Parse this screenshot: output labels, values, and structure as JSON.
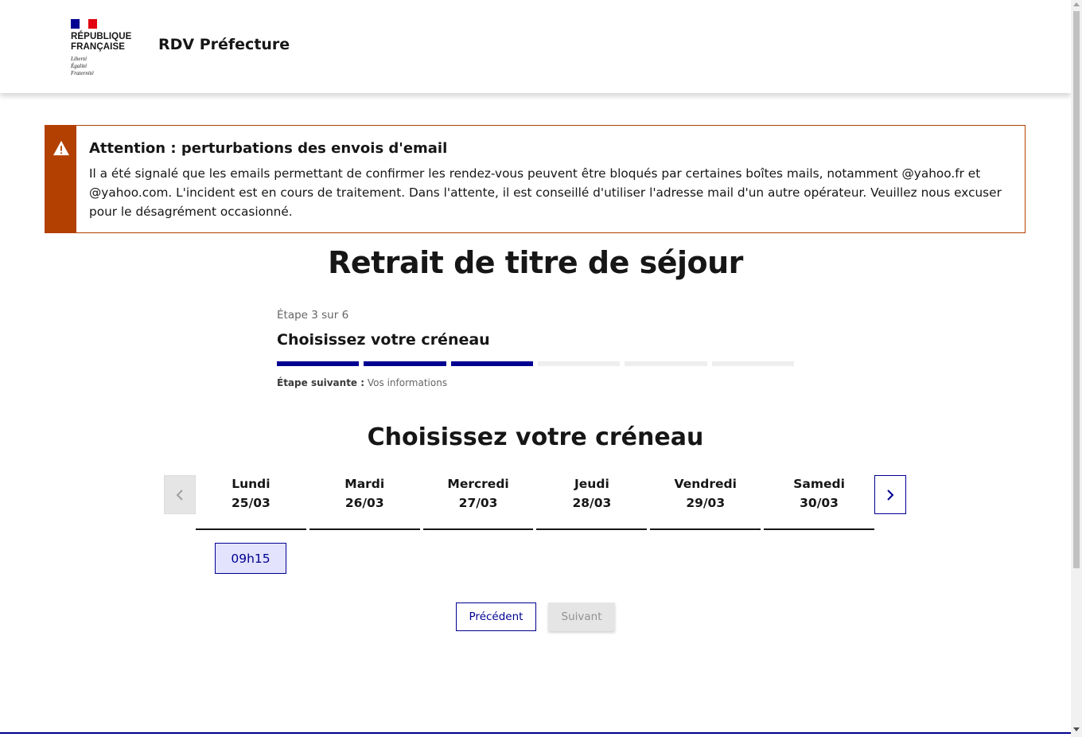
{
  "header": {
    "logo_name": "RÉPUBLIQUE\nFRANÇAISE",
    "logo_motto": "Liberté\nÉgalité\nFraternité",
    "service_title": "RDV Préfecture"
  },
  "alert": {
    "icon": "warning-icon",
    "title": "Attention : perturbations des envois d'email",
    "text": "Il a été signalé que les emails permettant de confirmer les rendez-vous peuvent être bloqués par certaines boîtes mails, notamment @yahoo.fr et @yahoo.com. L'incident est en cours de traitement. Dans l'attente, il est conseillé d'utiliser l'adresse mail d'un autre opérateur. Veuillez nous excuser pour le désagrément occasionné."
  },
  "page_title": "Retrait de titre de séjour",
  "stepper": {
    "state": "Étape 3 sur 6",
    "title": "Choisissez votre créneau",
    "total_steps": 6,
    "current_step": 3,
    "next_label": "Étape suivante :",
    "next_value": "Vos informations"
  },
  "section_title": "Choisissez votre créneau",
  "calendar": {
    "prev_icon": "chevron-left-icon",
    "next_icon": "chevron-right-icon",
    "days": [
      {
        "name": "Lundi",
        "date": "25/03"
      },
      {
        "name": "Mardi",
        "date": "26/03"
      },
      {
        "name": "Mercredi",
        "date": "27/03"
      },
      {
        "name": "Jeudi",
        "date": "28/03"
      },
      {
        "name": "Vendredi",
        "date": "29/03"
      },
      {
        "name": "Samedi",
        "date": "30/03"
      }
    ],
    "slots": [
      {
        "day": "Lundi",
        "time": "09h15",
        "selected": true
      }
    ]
  },
  "actions": {
    "previous_label": "Précédent",
    "next_label": "Suivant",
    "next_disabled": true
  },
  "colors": {
    "primary": "#000091",
    "warning": "#b34000",
    "flag_blue": "#000091",
    "flag_white": "#ffffff",
    "flag_red": "#e1000f"
  }
}
